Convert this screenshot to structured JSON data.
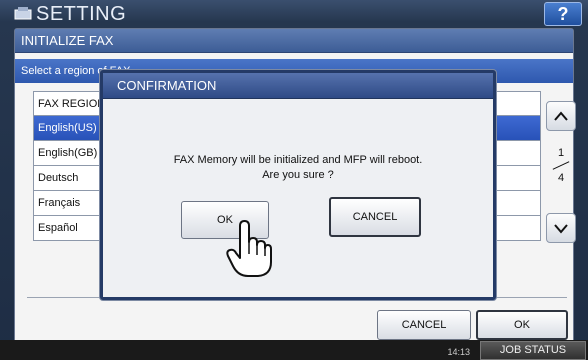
{
  "screen": {
    "title": "SETTING",
    "help_label": "?"
  },
  "panel": {
    "header": "INITIALIZE FAX",
    "subheader": "Select a region of FAX.",
    "list_header": "FAX REGION",
    "items": [
      {
        "label": "English(US)",
        "selected": true
      },
      {
        "label": "English(GB)",
        "selected": false
      },
      {
        "label": "Deutsch",
        "selected": false
      },
      {
        "label": "Français",
        "selected": false
      },
      {
        "label": "Español",
        "selected": false
      }
    ],
    "page_current": "1",
    "page_total": "4",
    "cancel_label": "CANCEL",
    "ok_label": "OK"
  },
  "dialog": {
    "title": "CONFIRMATION",
    "message_line1": "FAX Memory will be initialized and MFP will reboot.",
    "message_line2": "Are you sure ?",
    "ok_label": "OK",
    "cancel_label": "CANCEL"
  },
  "status": {
    "time": "14:13",
    "job_status_label": "JOB STATUS"
  },
  "colors": {
    "header_blue": "#3d5d96",
    "selected_row": "#2852b8",
    "dialog_border": "#243a66"
  }
}
